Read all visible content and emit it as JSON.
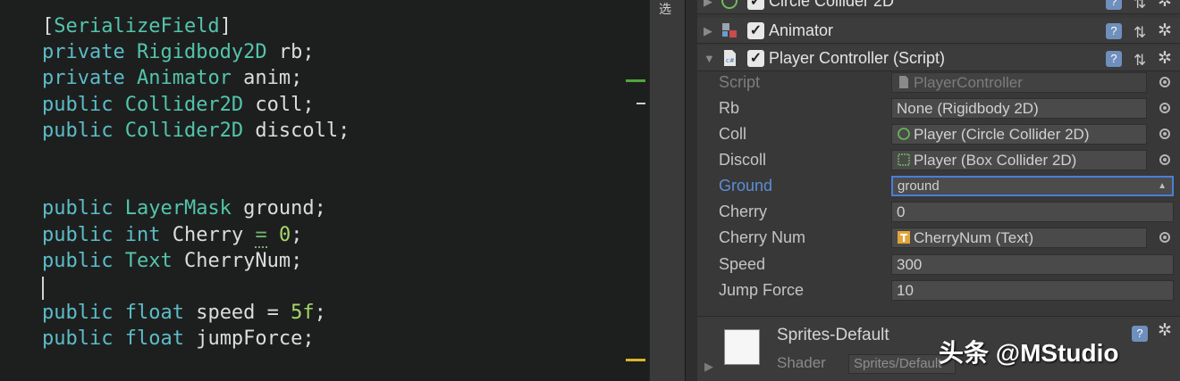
{
  "editor": {
    "lines": [
      {
        "tokens": [
          {
            "t": "[",
            "c": "pl"
          },
          {
            "t": "SerializeField",
            "c": "ty"
          },
          {
            "t": "]",
            "c": "pl"
          }
        ]
      },
      {
        "tokens": [
          {
            "t": "private ",
            "c": "kw"
          },
          {
            "t": "Rigidbody2D",
            "c": "ty"
          },
          {
            "t": " rb;",
            "c": "pl"
          }
        ]
      },
      {
        "tokens": [
          {
            "t": "private ",
            "c": "kw"
          },
          {
            "t": "Animator",
            "c": "ty"
          },
          {
            "t": " anim;",
            "c": "pl"
          }
        ]
      },
      {
        "tokens": [
          {
            "t": "public ",
            "c": "kw"
          },
          {
            "t": "Collider2D",
            "c": "ty"
          },
          {
            "t": " coll;",
            "c": "pl"
          }
        ]
      },
      {
        "tokens": [
          {
            "t": "public ",
            "c": "kw"
          },
          {
            "t": "Collider2D",
            "c": "ty"
          },
          {
            "t": " discoll;",
            "c": "pl"
          }
        ]
      },
      {
        "tokens": []
      },
      {
        "tokens": []
      },
      {
        "tokens": [
          {
            "t": "public ",
            "c": "kw"
          },
          {
            "t": "LayerMask",
            "c": "ty"
          },
          {
            "t": " ground;",
            "c": "pl"
          }
        ]
      },
      {
        "tokens": [
          {
            "t": "public ",
            "c": "kw"
          },
          {
            "t": "int",
            "c": "kw"
          },
          {
            "t": " Cherry ",
            "c": "pl"
          },
          {
            "t": "=",
            "c": "op-dotted"
          },
          {
            "t": " ",
            "c": "pl"
          },
          {
            "t": "0",
            "c": "num"
          },
          {
            "t": ";",
            "c": "pl"
          }
        ]
      },
      {
        "tokens": [
          {
            "t": "public ",
            "c": "kw"
          },
          {
            "t": "Text",
            "c": "ty"
          },
          {
            "t": " CherryNum;",
            "c": "pl"
          }
        ]
      },
      {
        "tokens": []
      },
      {
        "tokens": [
          {
            "t": "public ",
            "c": "kw"
          },
          {
            "t": "float",
            "c": "kw"
          },
          {
            "t": " speed = ",
            "c": "pl"
          },
          {
            "t": "5f",
            "c": "num"
          },
          {
            "t": ";",
            "c": "pl"
          }
        ]
      },
      {
        "tokens": [
          {
            "t": "public ",
            "c": "kw"
          },
          {
            "t": "float",
            "c": "kw"
          },
          {
            "t": " jumpForce;",
            "c": "pl"
          }
        ]
      }
    ]
  },
  "divider": {
    "label": "选"
  },
  "inspector": {
    "components": [
      {
        "name": "Circle Collider 2D",
        "icon": "circle-collider-icon"
      },
      {
        "name": "Animator",
        "icon": "animator-icon"
      },
      {
        "name": "Player Controller (Script)",
        "icon": "script-icon"
      }
    ],
    "help_glyph": "?",
    "preset_glyph": "⇅",
    "gear_glyph": "✲",
    "check_glyph": "✓",
    "properties": [
      {
        "label": "Script",
        "value": "PlayerController",
        "kind": "disabled",
        "icon": "script-file-icon"
      },
      {
        "label": "Rb",
        "value": "None (Rigidbody 2D)",
        "kind": "object"
      },
      {
        "label": "Coll",
        "value": "Player (Circle Collider 2D)",
        "kind": "object",
        "icon": "circle-collider-icon"
      },
      {
        "label": "Discoll",
        "value": "Player (Box Collider 2D)",
        "kind": "object",
        "icon": "box-collider-icon"
      },
      {
        "label": "Ground",
        "value": "ground",
        "kind": "dropdown"
      },
      {
        "label": "Cherry",
        "value": "0",
        "kind": "text"
      },
      {
        "label": "Cherry Num",
        "value": "CherryNum (Text)",
        "kind": "object",
        "icon": "text-component-icon"
      },
      {
        "label": "Speed",
        "value": "300",
        "kind": "text"
      },
      {
        "label": "Jump Force",
        "value": "10",
        "kind": "text"
      }
    ],
    "material": {
      "name": "Sprites-Default",
      "shader_label": "Shader",
      "shader_value": "Sprites/Default"
    }
  },
  "watermark": "头条 @MStudio",
  "colors": {
    "keyword": "#5cbcc9",
    "type": "#53c5ad",
    "number": "#a6d76c",
    "highlight_label": "#5b8ed6",
    "gutter_green": "#4fa83b",
    "gutter_yellow": "#d8b62c"
  }
}
